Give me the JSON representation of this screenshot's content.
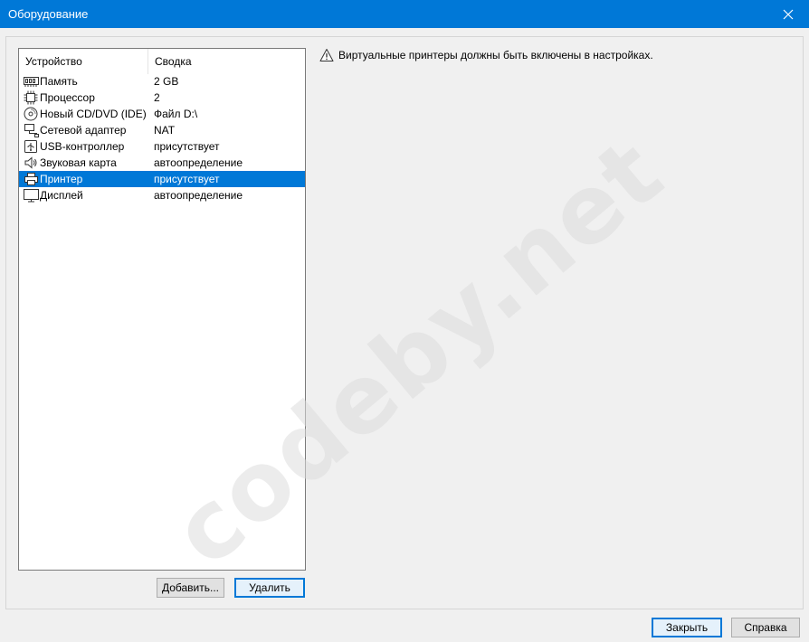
{
  "window": {
    "title": "Оборудование"
  },
  "device_list": {
    "columns": [
      "Устройство",
      "Сводка"
    ],
    "rows": [
      {
        "icon": "memory-icon",
        "name": "Память",
        "summary": "2 GB"
      },
      {
        "icon": "processor-icon",
        "name": "Процессор",
        "summary": "2"
      },
      {
        "icon": "cd-dvd-icon",
        "name": "Новый CD/DVD (IDE)",
        "summary": "Файл D:\\"
      },
      {
        "icon": "network-adapter-icon",
        "name": "Сетевой адаптер",
        "summary": "NAT"
      },
      {
        "icon": "usb-icon",
        "name": "USB-контроллер",
        "summary": "присутствует"
      },
      {
        "icon": "sound-icon",
        "name": "Звуковая карта",
        "summary": "автоопределение"
      },
      {
        "icon": "printer-icon",
        "name": "Принтер",
        "summary": "присутствует",
        "selected": true
      },
      {
        "icon": "display-icon",
        "name": "Дисплей",
        "summary": "автоопределение"
      }
    ]
  },
  "notice": {
    "icon": "warning-icon",
    "text": "Виртуальные принтеры должны быть включены в настройках."
  },
  "buttons": {
    "add": "Добавить...",
    "remove": "Удалить",
    "close": "Закрыть",
    "help": "Справка"
  },
  "watermark": "codeby.net",
  "colors": {
    "titlebar": "#0078d7",
    "selection": "#0078d7"
  }
}
